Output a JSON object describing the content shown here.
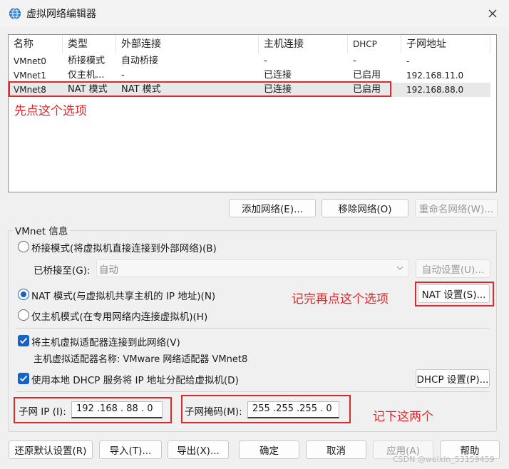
{
  "window": {
    "title": "虚拟网络编辑器",
    "icon": "network-globe-icon"
  },
  "network_table": {
    "columns": [
      "名称",
      "类型",
      "外部连接",
      "主机连接",
      "DHCP",
      "子网地址"
    ],
    "rows": [
      {
        "name": "VMnet0",
        "type": "桥接模式",
        "external": "自动桥接",
        "host": "-",
        "dhcp": "-",
        "subnet": "-"
      },
      {
        "name": "VMnet1",
        "type": "仅主机...",
        "external": "-",
        "host": "已连接",
        "dhcp": "已启用",
        "subnet": "192.168.11.0"
      },
      {
        "name": "VMnet8",
        "type": "NAT 模式",
        "external": "NAT 模式",
        "host": "已连接",
        "dhcp": "已启用",
        "subnet": "192.168.88.0"
      }
    ],
    "selected_row": "VMnet8"
  },
  "list_buttons": {
    "add": "添加网络(E)...",
    "remove": "移除网络(O)",
    "rename": "重命名网络(W)..."
  },
  "info": {
    "group_title": "VMnet 信息",
    "bridged_radio": "桥接模式(将虚拟机直接连接到外部网络)(B)",
    "bridged_to_label": "已桥接至(G):",
    "bridged_to_value": "自动",
    "auto_settings": "自动设置(U)...",
    "nat_radio": "NAT 模式(与虚拟机共享主机的 IP 地址)(N)",
    "nat_settings": "NAT 设置(S)...",
    "hostonly_radio": "仅主机模式(在专用网络内连接虚拟机)(H)",
    "connect_adapter_check": "将主机虚拟适配器连接到此网络(V)",
    "adapter_name_text": "主机虚拟适配器名称: VMware 网络适配器 VMnet8",
    "dhcp_check": "使用本地 DHCP 服务将 IP 地址分配给虚拟机(D)",
    "dhcp_settings": "DHCP 设置(P)...",
    "subnet_ip_label": "子网 IP (I):",
    "subnet_ip_value": "192 .168 . 88 .  0",
    "subnet_mask_label": "子网掩码(M):",
    "subnet_mask_value": "255 .255 .255 .  0"
  },
  "bottom_buttons": {
    "restore": "还原默认设置(R)",
    "import": "导入(T)...",
    "export": "导出(X)...",
    "ok": "确定",
    "cancel": "取消",
    "apply": "应用(A)",
    "help": "帮助"
  },
  "annotations": {
    "first": "先点这个选项",
    "second": "记完再点这个选项",
    "third": "记下这两个"
  },
  "watermark": "CSDN @weixin_53159459",
  "colors": {
    "annotation_red": "#e0272a",
    "accent_blue": "#1663c7"
  }
}
